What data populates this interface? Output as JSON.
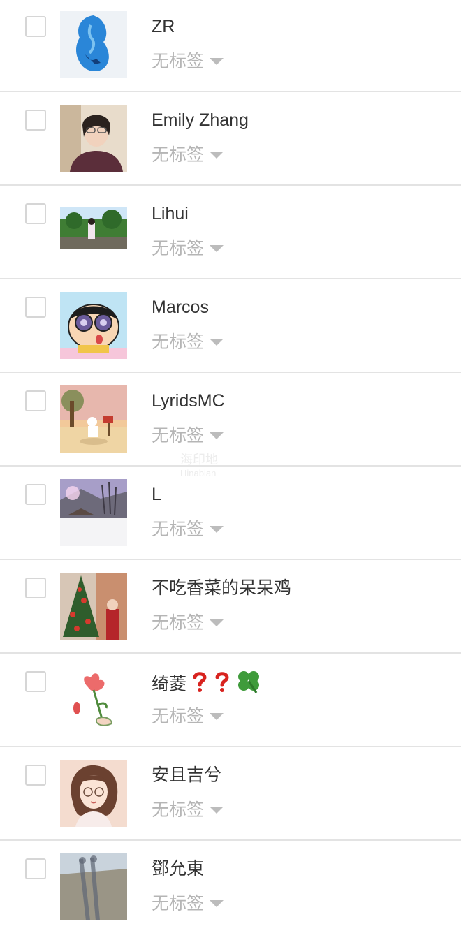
{
  "contacts": [
    {
      "name": "ZR",
      "tag": "无标签",
      "avatar": "mermaid-silhouette-avatar"
    },
    {
      "name": "Emily Zhang",
      "tag": "无标签",
      "avatar": "woman-with-glasses-photo-avatar"
    },
    {
      "name": "Lihui",
      "tag": "无标签",
      "avatar": "park-photo-avatar"
    },
    {
      "name": "Marcos",
      "tag": "无标签",
      "avatar": "cartoon-binoculars-avatar"
    },
    {
      "name": "LyridsMC",
      "tag": "无标签",
      "avatar": "illustrated-scene-avatar"
    },
    {
      "name": "L",
      "tag": "无标签",
      "avatar": "snowy-village-photo-avatar"
    },
    {
      "name": "不吃香菜的呆呆鸡",
      "tag": "无标签",
      "avatar": "christmas-tree-photo-avatar"
    },
    {
      "name": "绮菱",
      "name_emojis": [
        "❓",
        "❓",
        "🍀"
      ],
      "tag": "无标签",
      "avatar": "hand-holding-flower-avatar"
    },
    {
      "name": "安且吉兮",
      "tag": "无标签",
      "avatar": "illustrated-girl-avatar"
    },
    {
      "name": "鄧允東",
      "tag": "无标签",
      "avatar": "shadow-photo-avatar"
    }
  ],
  "watermark": {
    "line1": "海印地",
    "line2": "Hinabian"
  },
  "colors": {
    "name": "#333333",
    "tag": "#b5b5b5",
    "divider": "#e3e3e3",
    "checkbox_border": "#d6d6d6"
  }
}
